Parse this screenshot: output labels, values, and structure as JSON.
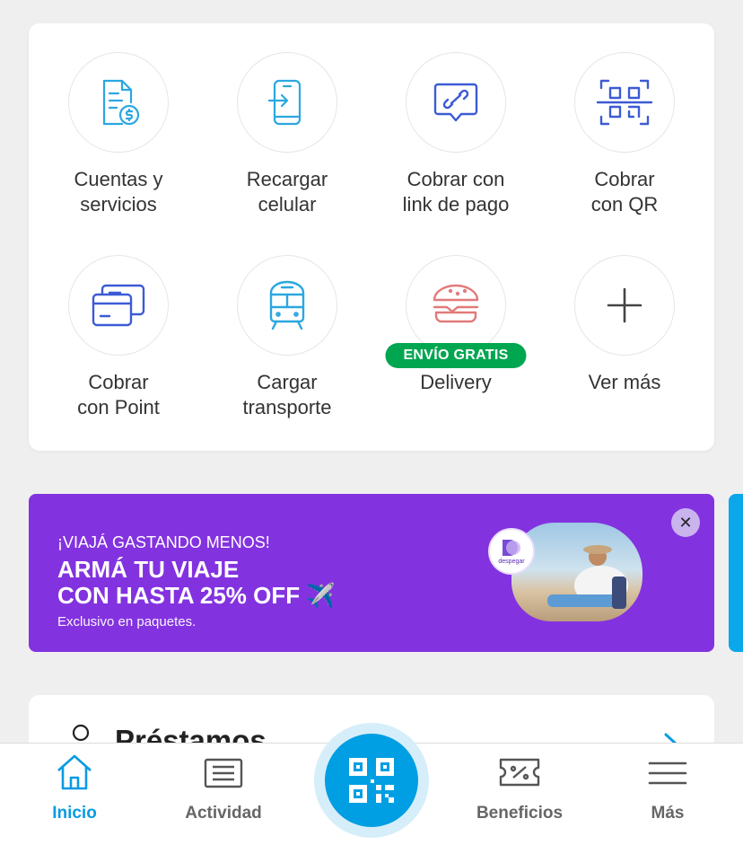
{
  "services": [
    {
      "label": "Cuentas y\nservicios",
      "icon": "bill-dollar-icon"
    },
    {
      "label": "Recargar\ncelular",
      "icon": "phone-recharge-icon"
    },
    {
      "label": "Cobrar con\nlink de pago",
      "icon": "link-chat-icon"
    },
    {
      "label": "Cobrar\ncon QR",
      "icon": "qr-scan-icon"
    },
    {
      "label": "Cobrar\ncon Point",
      "icon": "card-reader-icon"
    },
    {
      "label": "Cargar\ntransporte",
      "icon": "train-icon"
    },
    {
      "label": "Delivery",
      "icon": "burger-icon",
      "badge": "ENVÍO GRATIS"
    },
    {
      "label": "Ver más",
      "icon": "plus-icon"
    }
  ],
  "promo": {
    "kicker": "¡VIAJÁ GASTANDO MENOS!",
    "headline": "ARMÁ TU VIAJE\nCON HASTA 25% OFF ✈️",
    "fine": "Exclusivo en paquetes.",
    "brand": "despegar",
    "close": "✕"
  },
  "loans": {
    "title": "Préstamos"
  },
  "tabbar": {
    "items": [
      {
        "label": "Inicio",
        "icon": "home-icon",
        "active": true
      },
      {
        "label": "Actividad",
        "icon": "activity-icon"
      },
      {
        "label": "Beneficios",
        "icon": "discount-ticket-icon"
      },
      {
        "label": "Más",
        "icon": "menu-icon"
      }
    ],
    "center": {
      "icon": "qr-icon"
    }
  },
  "colors": {
    "accent": "#009ee3",
    "promo": "#8332e0",
    "badge": "#00a650",
    "icon_light": "#2ba7e0",
    "icon_dark": "#3c5bd4",
    "icon_red": "#e27a7a"
  }
}
